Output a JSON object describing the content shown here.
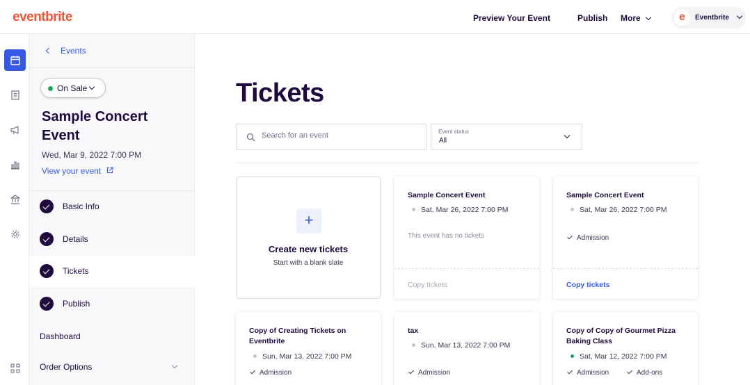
{
  "header": {
    "logo": "eventbrite",
    "preview": "Preview Your Event",
    "publish": "Publish",
    "more": "More",
    "account_name": "Eventbrite",
    "account_initial": "e"
  },
  "sidebar": {
    "back_label": "Events",
    "status": "On Sale",
    "event_title": "Sample Concert Event",
    "event_date": "Wed, Mar 9, 2022 7:00 PM",
    "view_link": "View your event",
    "steps": [
      {
        "label": "Basic Info"
      },
      {
        "label": "Details"
      },
      {
        "label": "Tickets"
      },
      {
        "label": "Publish"
      }
    ],
    "dashboard": "Dashboard",
    "order_options": "Order Options"
  },
  "main": {
    "title": "Tickets",
    "search_placeholder": "Search for an event",
    "status_label": "Event status",
    "status_value": "All",
    "create_card": {
      "icon": "+",
      "title": "Create new tickets",
      "subtitle": "Start with a blank slate"
    },
    "cards": [
      {
        "title": "Sample Concert Event",
        "date": "Sat, Mar 26, 2022 7:00 PM",
        "note": "This event has no tickets",
        "action": "Copy tickets"
      },
      {
        "title": "Sample Concert Event",
        "date": "Sat, Mar 26, 2022 7:00 PM",
        "tag": "Admission",
        "action": "Copy tickets"
      },
      {
        "title": "Copy of Creating Tickets on Eventbrite",
        "date": "Sun, Mar 13, 2022 7:00 PM",
        "tag": "Admission"
      },
      {
        "title": "tax",
        "date": "Sun, Mar 13, 2022 7:00 PM",
        "tag": "Admission"
      },
      {
        "title": "Copy of Copy of Gourmet Pizza Baking Class",
        "date": "Sat, Mar 12, 2022 7:00 PM",
        "tag": "Admission",
        "tag2": "Add-ons"
      }
    ]
  },
  "colors": {
    "brand": "#f05537",
    "accent": "#3659e3",
    "text": "#1e0a3c",
    "live": "#19a35c"
  }
}
